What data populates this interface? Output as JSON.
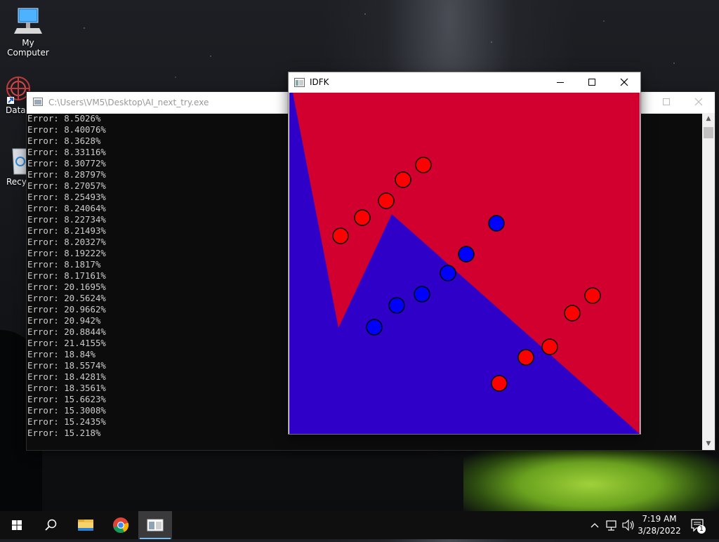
{
  "desktop": {
    "icons": [
      {
        "label": "My Computer"
      },
      {
        "label": "DataW"
      },
      {
        "label": "Recyc"
      }
    ]
  },
  "console": {
    "title": "C:\\Users\\VM5\\Desktop\\AI_next_try.exe",
    "lines": [
      "Error: 8.5026%",
      "Error: 8.40076%",
      "Error: 8.3628%",
      "Error: 8.33116%",
      "Error: 8.30772%",
      "Error: 8.28797%",
      "Error: 8.27057%",
      "Error: 8.25493%",
      "Error: 8.24064%",
      "Error: 8.22734%",
      "Error: 8.21493%",
      "Error: 8.20327%",
      "Error: 8.19222%",
      "Error: 8.1817%",
      "Error: 8.17161%",
      "Error: 20.1695%",
      "Error: 20.5624%",
      "Error: 20.9662%",
      "Error: 20.942%",
      "Error: 20.8844%",
      "Error: 21.4155%",
      "Error: 18.84%",
      "Error: 18.5574%",
      "Error: 18.4281%",
      "Error: 18.3561%",
      "Error: 15.6623%",
      "Error: 15.3008%",
      "Error: 15.2435%",
      "Error: 15.218%"
    ]
  },
  "idfk_window": {
    "title": "IDFK",
    "colors": {
      "red_region": "#d2002e",
      "blue_region": "#2e00c8",
      "red_point": "#ff0000",
      "blue_point": "#0000ff"
    }
  },
  "taskbar": {
    "time": "7:19 AM",
    "date": "3/28/2022",
    "notification_count": "1",
    "icons": [
      "start-icon",
      "search-icon",
      "file-explorer-icon",
      "chrome-icon",
      "console-app-icon"
    ]
  }
}
